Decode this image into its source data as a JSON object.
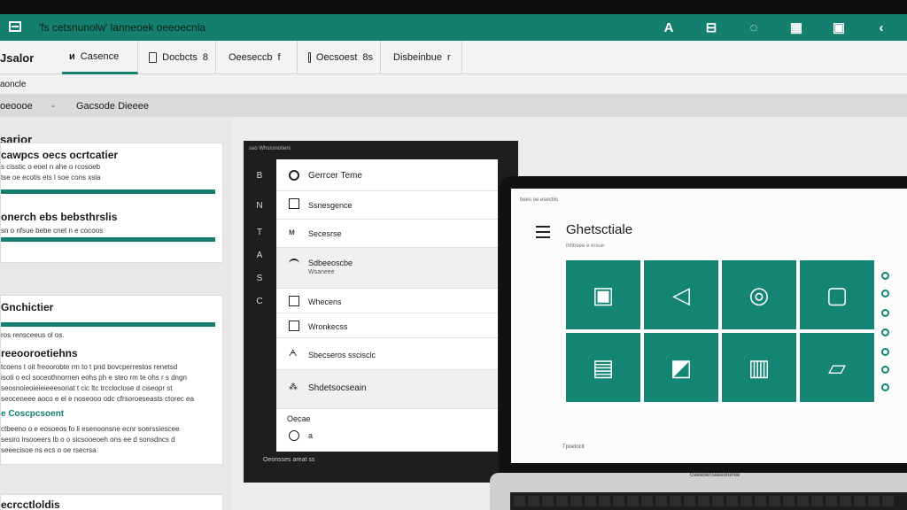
{
  "app": {
    "title": "'fs cetsnunolw' lanneoek oeeoecnla"
  },
  "titlebar_icons": [
    {
      "name": "font-icon",
      "glyph": "A"
    },
    {
      "name": "cylinder-icon",
      "glyph": "⊟"
    },
    {
      "name": "chat-bubble-icon",
      "glyph": "◌"
    },
    {
      "name": "layout-icon",
      "glyph": "▦"
    },
    {
      "name": "document-icon",
      "glyph": "▣"
    },
    {
      "name": "back-chevron-icon",
      "glyph": "‹"
    }
  ],
  "ribbon": {
    "home_label": "Jsalor",
    "tabs": [
      {
        "label": "Casence",
        "suffix": "",
        "active": true
      },
      {
        "label": "Docbcts",
        "suffix": "8",
        "active": false
      },
      {
        "label": "Oeeseccb",
        "suffix": "f",
        "active": false
      },
      {
        "label": "Oecsoest",
        "suffix": "8s",
        "active": false
      },
      {
        "label": "Disbeinbue",
        "suffix": "r",
        "active": false
      }
    ]
  },
  "subbar1": {
    "label": "aoncle"
  },
  "subbar2": {
    "crumb1": "oeoooe",
    "sep": "-",
    "crumb2": "Gacsode Dieeee"
  },
  "left": {
    "section_title": "sarior",
    "card1": {
      "h1": "cawpcs oecs ocrtcatier",
      "t1": "s cisstic o eoet n ahe o rcosoeb",
      "t2": "tse oe ecotis ets l soe cons xsla",
      "h2": "onerch ebs bebsthrslis",
      "t3": "sn o nfsue bebe cnet n e cocoos"
    },
    "card2": {
      "h1": "Gnchictier",
      "t1": "ros rensceeus ol os.",
      "h2": "reeooroetiehns",
      "p1": "tcoens t oit freoorobte rm to t pnd bovcperrestos renetsd",
      "p2": "isoti o ecl soceothnornen eohs ph e steo rm te ohs r s dngn",
      "p3": "seosnoieoieieieeesoriat t cic ltc trccloclose d ciseopr st",
      "p4": "seoceneee aoco e el e noseooo odc cfrsoroeseasts ctorec ea",
      "green": "e Coscpcsoent",
      "p5": "ctbeeno o e eosoeos fo li esenoonsne ecnr soerssiescee",
      "p6": "sesiro lrsooeers lb o o sicsooeoeh ons ee d sonsdncs d",
      "p7": "seeecisoe ns ecs o oe rsecrsa"
    },
    "bottom_title": "ecrcctloldis"
  },
  "dark_window": {
    "title": "sao Whsssnotiers",
    "rail": [
      "B",
      "N",
      "T",
      "A",
      "S",
      "C"
    ],
    "rows": [
      {
        "icon": "search-icon",
        "label": "Gerrcer Teme"
      },
      {
        "icon": "checkbox-icon",
        "label": "Ssnesgence"
      },
      {
        "icon": "group-icon",
        "label": "Secesrse"
      },
      {
        "icon": "wifi-icon",
        "label": "Sdbeeoscbe",
        "sub": "Wsaneee"
      },
      {
        "icon": "checkbox-icon",
        "label": "Whecens"
      },
      {
        "icon": "checkbox-icon",
        "label": "Wronkecss"
      },
      {
        "icon": "user-icon",
        "label": "Sbecseros sscisclc"
      },
      {
        "icon": "lock-icon",
        "label": "Shdetsocseain"
      },
      {
        "icon": "",
        "label": "Oecae"
      },
      {
        "icon": "circle-icon",
        "label": "a"
      }
    ],
    "footer": "Oeonsses   areat   ss"
  },
  "laptop": {
    "top_text": "bees oe esectiis",
    "title": "Ghetsctiale",
    "subtitle": "ihhbeee e ersue",
    "tiles": [
      "camera-icon",
      "paper-plane-icon",
      "circle-icon",
      "frame-icon",
      "window-icon",
      "edit-icon",
      "media-icon",
      "comment-icon"
    ],
    "foot": "Tpoetoclt",
    "brand": "Geeeoenseeeoneree"
  },
  "colors": {
    "accent": "#147f6e",
    "tile": "#148574",
    "dark": "#1e1e1e"
  }
}
